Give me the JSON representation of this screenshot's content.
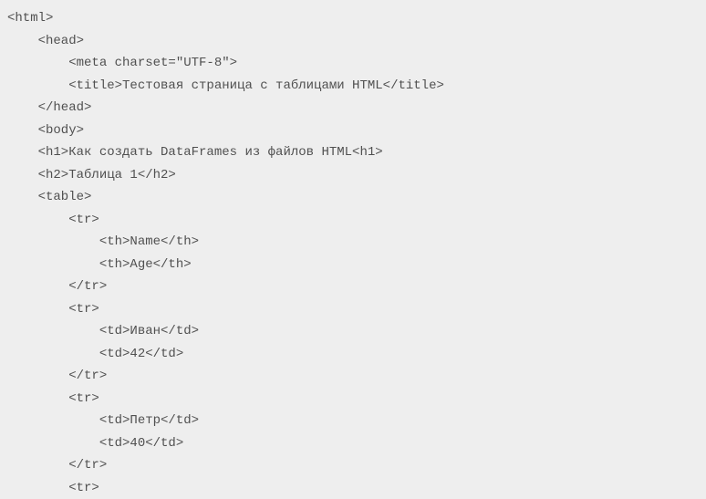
{
  "lines": [
    {
      "indent": 0,
      "text": "<html>"
    },
    {
      "indent": 1,
      "text": "<head>"
    },
    {
      "indent": 2,
      "text": "<meta charset=\"UTF-8\">"
    },
    {
      "indent": 2,
      "text": "<title>Тестовая страница с таблицами HTML</title>"
    },
    {
      "indent": 1,
      "text": "</head>"
    },
    {
      "indent": 1,
      "text": "<body>"
    },
    {
      "indent": 1,
      "text": "<h1>Как создать DataFrames из файлов HTML<h1>"
    },
    {
      "indent": 1,
      "text": "<h2>Таблица 1</h2>"
    },
    {
      "indent": 1,
      "text": "<table>"
    },
    {
      "indent": 2,
      "text": "<tr>"
    },
    {
      "indent": 3,
      "text": "<th>Name</th>"
    },
    {
      "indent": 3,
      "text": "<th>Age</th>"
    },
    {
      "indent": 2,
      "text": "</tr>"
    },
    {
      "indent": 2,
      "text": "<tr>"
    },
    {
      "indent": 3,
      "text": "<td>Иван</td>"
    },
    {
      "indent": 3,
      "text": "<td>42</td>"
    },
    {
      "indent": 2,
      "text": "</tr>"
    },
    {
      "indent": 2,
      "text": "<tr>"
    },
    {
      "indent": 3,
      "text": "<td>Петр</td>"
    },
    {
      "indent": 3,
      "text": "<td>40</td>"
    },
    {
      "indent": 2,
      "text": "</tr>"
    },
    {
      "indent": 2,
      "text": "<tr>"
    }
  ],
  "indentUnit": "    "
}
